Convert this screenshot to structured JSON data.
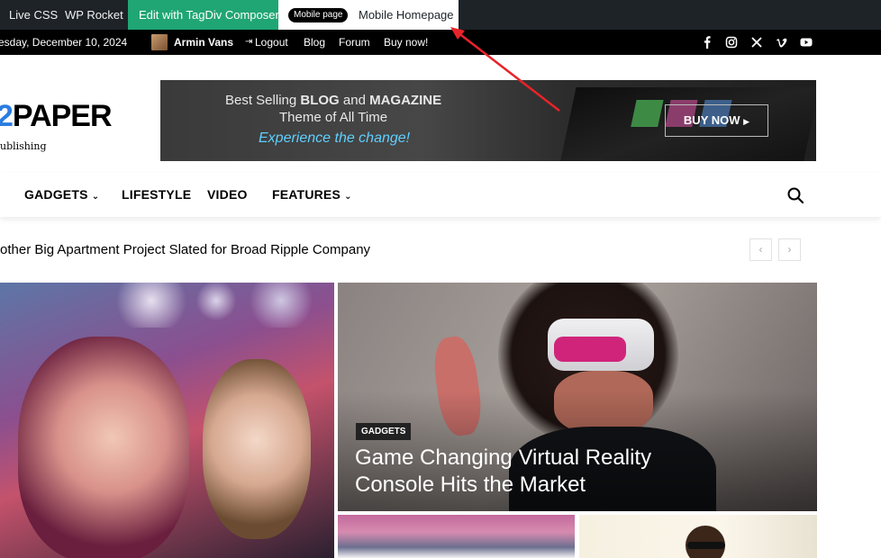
{
  "admin_bar": {
    "live_css": "Live CSS",
    "wp_rocket": "WP Rocket",
    "edit_composer": "Edit with TagDiv Composer",
    "mobile_pill": "Mobile page",
    "mobile_homepage": "Mobile Homepage"
  },
  "top_bar": {
    "date": "esday, December 10, 2024",
    "user": "Armin Vans",
    "logout": "Logout",
    "links": [
      "Blog",
      "Forum",
      "Buy now!"
    ],
    "social_icons": [
      "facebook-icon",
      "instagram-icon",
      "x-icon",
      "vimeo-icon",
      "youtube-icon"
    ]
  },
  "logo": {
    "text_accent": "2",
    "text": "PAPER",
    "sub": "ublishing"
  },
  "banner": {
    "line1_pre": "Best Selling ",
    "line1_b1": "BLOG",
    "line1_mid": " and ",
    "line1_b2": "MAGAZINE",
    "line2": "Theme of All Time",
    "line3": "Experience the change!",
    "buy": "BUY NOW"
  },
  "nav": {
    "items": [
      "GADGETS",
      "LIFESTYLE",
      "VIDEO",
      "FEATURES"
    ]
  },
  "ticker": {
    "text": "other Big Apartment Project Slated for Broad Ripple Company"
  },
  "featured": {
    "tag": "GADGETS",
    "headline": "Game Changing Virtual Reality Console Hits the Market"
  },
  "colors": {
    "admin_bg": "#1d2327",
    "composer_green": "#20a574",
    "accent_blue": "#2a7de1",
    "arrow_red": "#e8232a"
  }
}
